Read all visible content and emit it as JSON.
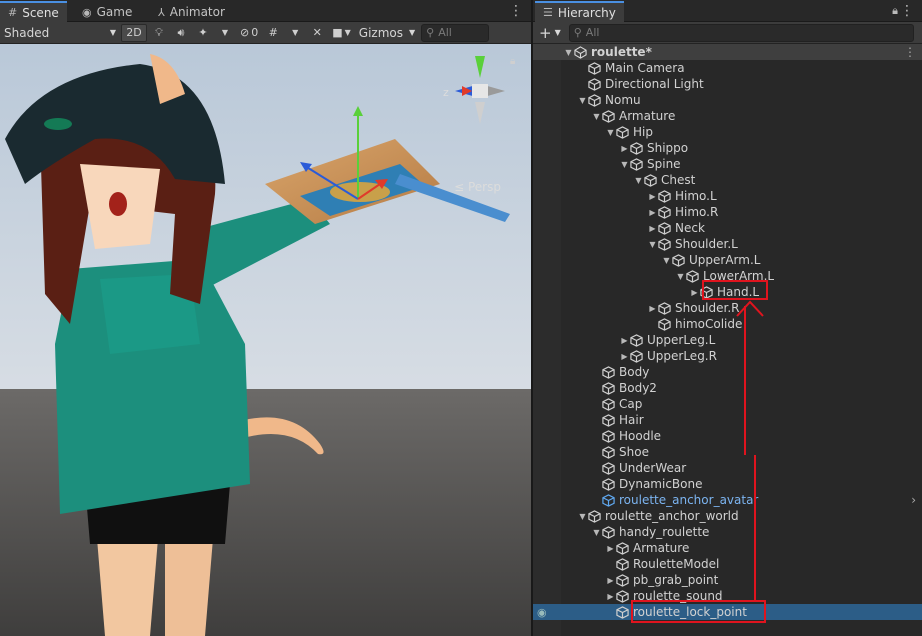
{
  "scene": {
    "tabs": [
      {
        "label": "Scene",
        "icon": "hash-icon"
      },
      {
        "label": "Game",
        "icon": "gamepad-icon"
      },
      {
        "label": "Animator",
        "icon": "animator-icon"
      }
    ],
    "toolbar": {
      "shading_mode": "Shaded",
      "mode_2d": "2D",
      "hidden_count": "0",
      "gizmos": "Gizmos",
      "search_placeholder": "All"
    },
    "view_label": "≤ Persp",
    "axis_z": "z"
  },
  "hierarchy": {
    "tab_label": "Hierarchy",
    "search_placeholder": "All",
    "rows": [
      {
        "label": "roulette*",
        "depth": 0,
        "arrow": "down",
        "type": "scene"
      },
      {
        "label": "Main Camera",
        "depth": 1,
        "arrow": "",
        "type": "go"
      },
      {
        "label": "Directional Light",
        "depth": 1,
        "arrow": "",
        "type": "go"
      },
      {
        "label": "Nomu",
        "depth": 1,
        "arrow": "down",
        "type": "go"
      },
      {
        "label": "Armature",
        "depth": 2,
        "arrow": "down",
        "type": "go"
      },
      {
        "label": "Hip",
        "depth": 3,
        "arrow": "down",
        "type": "go"
      },
      {
        "label": "Shippo",
        "depth": 4,
        "arrow": "right",
        "type": "go"
      },
      {
        "label": "Spine",
        "depth": 4,
        "arrow": "down",
        "type": "go"
      },
      {
        "label": "Chest",
        "depth": 5,
        "arrow": "down",
        "type": "go"
      },
      {
        "label": "Himo.L",
        "depth": 6,
        "arrow": "right",
        "type": "go"
      },
      {
        "label": "Himo.R",
        "depth": 6,
        "arrow": "right",
        "type": "go"
      },
      {
        "label": "Neck",
        "depth": 6,
        "arrow": "right",
        "type": "go"
      },
      {
        "label": "Shoulder.L",
        "depth": 6,
        "arrow": "down",
        "type": "go"
      },
      {
        "label": "UpperArm.L",
        "depth": 7,
        "arrow": "down",
        "type": "go"
      },
      {
        "label": "LowerArm.L",
        "depth": 8,
        "arrow": "down",
        "type": "go"
      },
      {
        "label": "Hand.L",
        "depth": 9,
        "arrow": "right",
        "type": "go"
      },
      {
        "label": "Shoulder.R",
        "depth": 6,
        "arrow": "right",
        "type": "go"
      },
      {
        "label": "himoColide",
        "depth": 6,
        "arrow": "",
        "type": "go"
      },
      {
        "label": "UpperLeg.L",
        "depth": 4,
        "arrow": "right",
        "type": "go"
      },
      {
        "label": "UpperLeg.R",
        "depth": 4,
        "arrow": "right",
        "type": "go"
      },
      {
        "label": "Body",
        "depth": 2,
        "arrow": "",
        "type": "go"
      },
      {
        "label": "Body2",
        "depth": 2,
        "arrow": "",
        "type": "go"
      },
      {
        "label": "Cap",
        "depth": 2,
        "arrow": "",
        "type": "go"
      },
      {
        "label": "Hair",
        "depth": 2,
        "arrow": "",
        "type": "go"
      },
      {
        "label": "Hoodle",
        "depth": 2,
        "arrow": "",
        "type": "go"
      },
      {
        "label": "Shoe",
        "depth": 2,
        "arrow": "",
        "type": "go"
      },
      {
        "label": "UnderWear",
        "depth": 2,
        "arrow": "",
        "type": "go"
      },
      {
        "label": "DynamicBone",
        "depth": 2,
        "arrow": "",
        "type": "go"
      },
      {
        "label": "roulette_anchor_avatar",
        "depth": 2,
        "arrow": "",
        "type": "prefab"
      },
      {
        "label": "roulette_anchor_world",
        "depth": 1,
        "arrow": "down",
        "type": "go"
      },
      {
        "label": "handy_roulette",
        "depth": 2,
        "arrow": "down",
        "type": "go"
      },
      {
        "label": "Armature",
        "depth": 3,
        "arrow": "right",
        "type": "go"
      },
      {
        "label": "RouletteModel",
        "depth": 3,
        "arrow": "",
        "type": "go"
      },
      {
        "label": "pb_grab_point",
        "depth": 3,
        "arrow": "right",
        "type": "go"
      },
      {
        "label": "roulette_sound",
        "depth": 3,
        "arrow": "right",
        "type": "go"
      },
      {
        "label": "roulette_lock_point",
        "depth": 3,
        "arrow": "",
        "type": "go",
        "selected": true
      }
    ]
  },
  "colors": {
    "selection": "#2c5d87",
    "highlight": "#e0141e",
    "prefab_text": "#7cb4f0",
    "accent_tab": "#4a90e2"
  }
}
